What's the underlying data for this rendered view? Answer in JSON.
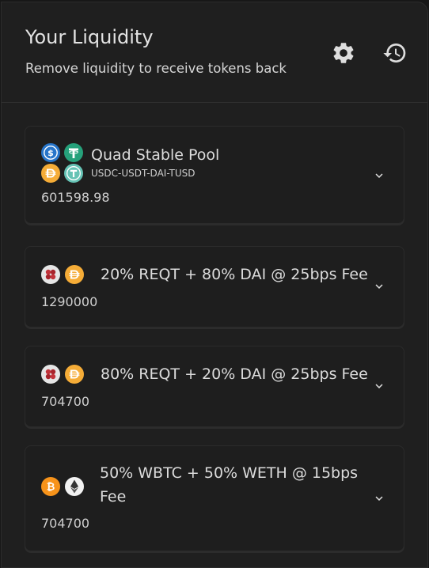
{
  "header": {
    "title": "Your Liquidity",
    "subtitle": "Remove liquidity to receive tokens back",
    "settings_icon": "gear-icon",
    "history_icon": "history-icon"
  },
  "pools": [
    {
      "name": "Quad Stable Pool",
      "tokens_label": "USDC-USDT-DAI-TUSD",
      "amount": "601598.98",
      "icons": [
        "usdc-icon",
        "usdt-icon",
        "dai-icon",
        "tusd-icon"
      ]
    },
    {
      "name": "20% REQT + 80% DAI @ 25bps Fee",
      "amount": "1290000",
      "icons": [
        "reqt-icon",
        "dai-icon"
      ]
    },
    {
      "name": "80% REQT + 20% DAI @ 25bps Fee",
      "amount": "704700",
      "icons": [
        "reqt-icon",
        "dai-icon"
      ]
    },
    {
      "name_line1": "50% WBTC + 50% WETH @ 15bps",
      "name_line2": "Fee",
      "amount": "704700",
      "icons": [
        "wbtc-icon",
        "weth-icon"
      ]
    }
  ],
  "colors": {
    "background": "#1f1f1f",
    "card": "#1e1e1e",
    "usdc": "#2775ca",
    "usdt": "#26a17b",
    "dai": "#f5ac37",
    "tusd": "#1a5aff",
    "wbtc": "#f7931a"
  }
}
